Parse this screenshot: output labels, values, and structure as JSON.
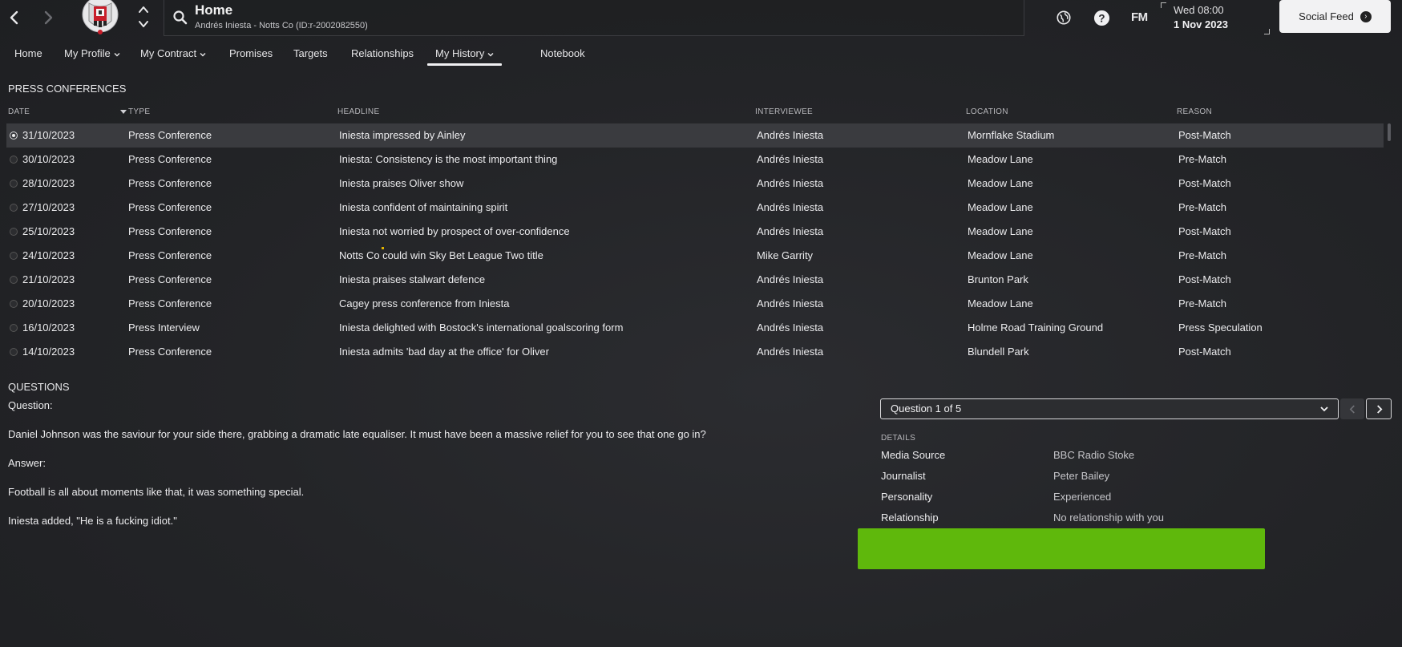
{
  "header": {
    "title": "Home",
    "subtitle": "Andrés Iniesta - Notts Co (ID:r-2002082550)",
    "clock_day": "Wed 08:00",
    "clock_date": "1 Nov 2023",
    "fm_logo": "FM",
    "social_feed_label": "Social Feed",
    "icons": [
      "back-arrow-icon",
      "forward-arrow-icon",
      "club-crest",
      "up-chevron-icon",
      "down-chevron-icon",
      "search-icon",
      "world-icon",
      "help-icon",
      "social-arrow-icon"
    ]
  },
  "tabs": [
    {
      "label": "Home",
      "dropdown": false
    },
    {
      "label": "My Profile",
      "dropdown": true
    },
    {
      "label": "My Contract",
      "dropdown": true
    },
    {
      "label": "Promises",
      "dropdown": false
    },
    {
      "label": "Targets",
      "dropdown": false
    },
    {
      "label": "Relationships",
      "dropdown": false
    },
    {
      "label": "My History",
      "dropdown": true,
      "active": true
    },
    {
      "label": "Notebook",
      "dropdown": false
    }
  ],
  "press": {
    "title": "PRESS CONFERENCES",
    "columns": {
      "date": "DATE",
      "type": "TYPE",
      "headline": "HEADLINE",
      "interviewee": "INTERVIEWEE",
      "location": "LOCATION",
      "reason": "REASON"
    },
    "rows": [
      {
        "date": "31/10/2023",
        "type": "Press Conference",
        "headline": "Iniesta impressed by Ainley",
        "interviewee": "Andrés Iniesta",
        "location": "Mornflake Stadium",
        "reason": "Post-Match"
      },
      {
        "date": "30/10/2023",
        "type": "Press Conference",
        "headline": "Iniesta: Consistency is the most important thing",
        "interviewee": "Andrés Iniesta",
        "location": "Meadow Lane",
        "reason": "Pre-Match"
      },
      {
        "date": "28/10/2023",
        "type": "Press Conference",
        "headline": "Iniesta praises Oliver show",
        "interviewee": "Andrés Iniesta",
        "location": "Meadow Lane",
        "reason": "Post-Match"
      },
      {
        "date": "27/10/2023",
        "type": "Press Conference",
        "headline": "Iniesta confident of maintaining spirit",
        "interviewee": "Andrés Iniesta",
        "location": "Meadow Lane",
        "reason": "Pre-Match"
      },
      {
        "date": "25/10/2023",
        "type": "Press Conference",
        "headline": "Iniesta not worried by prospect of over-confidence",
        "interviewee": "Andrés Iniesta",
        "location": "Meadow Lane",
        "reason": "Post-Match"
      },
      {
        "date": "24/10/2023",
        "type": "Press Conference",
        "headline": "Notts Co could win Sky Bet League Two title",
        "interviewee": "Mike Garrity",
        "location": "Meadow Lane",
        "reason": "Pre-Match"
      },
      {
        "date": "21/10/2023",
        "type": "Press Conference",
        "headline": "Iniesta praises stalwart defence",
        "interviewee": "Andrés Iniesta",
        "location": "Brunton Park",
        "reason": "Post-Match"
      },
      {
        "date": "20/10/2023",
        "type": "Press Conference",
        "headline": "Cagey press conference from Iniesta",
        "interviewee": "Andrés Iniesta",
        "location": "Meadow Lane",
        "reason": "Pre-Match"
      },
      {
        "date": "16/10/2023",
        "type": "Press Interview",
        "headline": "Iniesta delighted with Bostock's international goalscoring form",
        "interviewee": "Andrés Iniesta",
        "location": "Holme Road Training Ground",
        "reason": "Press Speculation"
      },
      {
        "date": "14/10/2023",
        "type": "Press Conference",
        "headline": "Iniesta admits 'bad day at the office' for Oliver",
        "interviewee": "Andrés Iniesta",
        "location": "Blundell Park",
        "reason": "Post-Match"
      }
    ]
  },
  "questions": {
    "title": "QUESTIONS",
    "question_label": "Question:",
    "question_text": "Daniel Johnson was the saviour for your side there, grabbing a dramatic late equaliser. It must have been a massive relief for you to see that one go in?",
    "answer_label": "Answer:",
    "answer_text": "Football is all about moments like that, it was something special.",
    "added_text": "Iniesta added, \"He is a fucking idiot.\"",
    "selector_value": "Question 1 of 5"
  },
  "details": {
    "title": "DETAILS",
    "items": [
      {
        "label": "Media Source",
        "value": "BBC Radio Stoke"
      },
      {
        "label": "Journalist",
        "value": "Peter Bailey"
      },
      {
        "label": "Personality",
        "value": "Experienced"
      },
      {
        "label": "Relationship",
        "value": "No relationship with you"
      }
    ]
  },
  "colors": {
    "background": "#242528",
    "selected_row": "#3a3b3f",
    "green_bar": "#5fb80c",
    "social_button": "#f2f2f3"
  }
}
